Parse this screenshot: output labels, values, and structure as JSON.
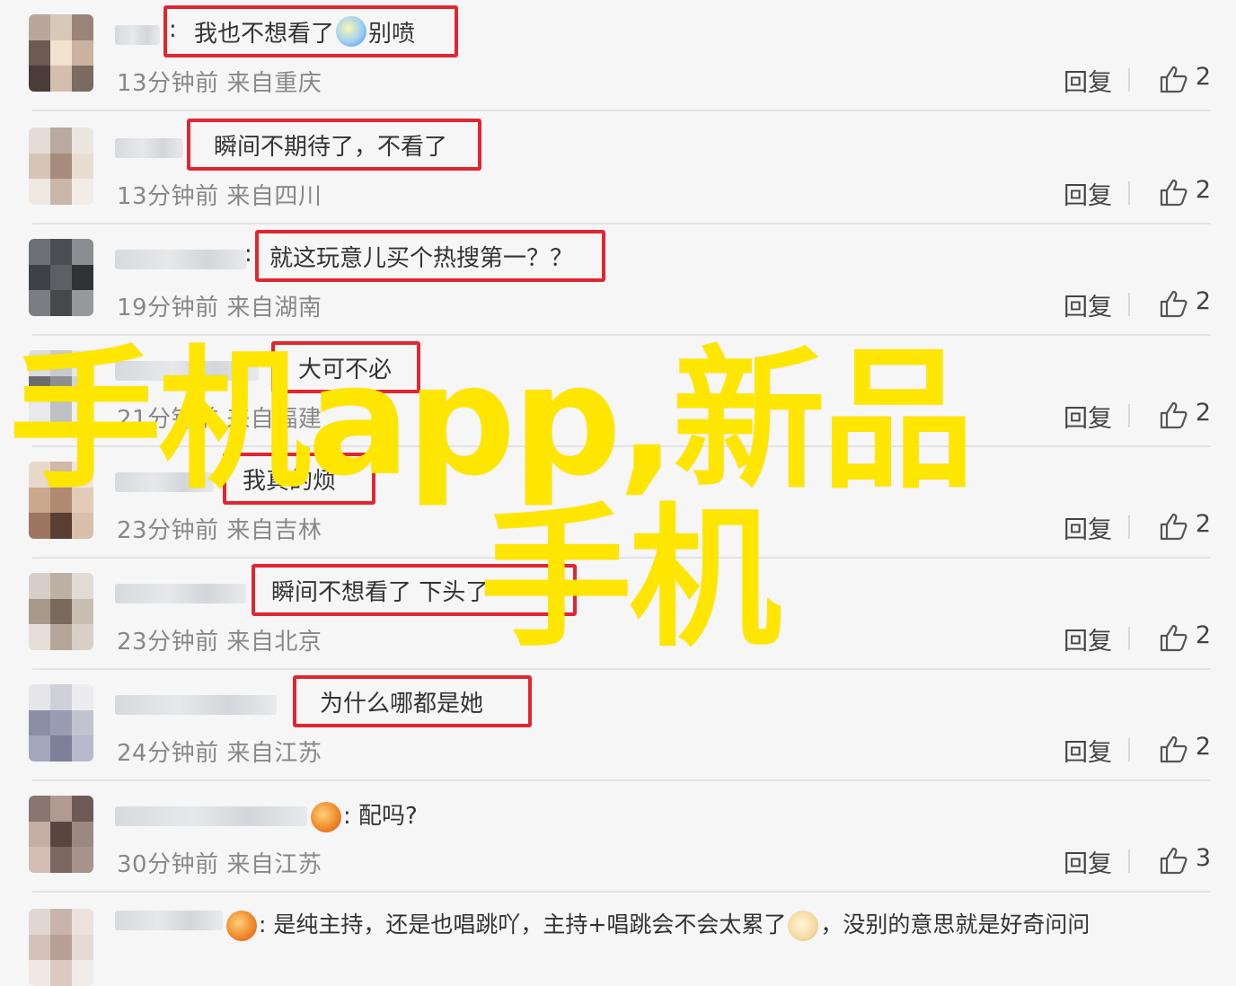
{
  "comments": [
    {
      "comment": "我也不想看了",
      "comment_suffix": "别喷",
      "emoji": "grinning-sweat-emoji",
      "meta": "13分钟前 来自重庆",
      "reply": "回复",
      "likes": "2"
    },
    {
      "comment": "瞬间不期待了，不看了",
      "meta": "13分钟前 来自四川",
      "reply": "回复",
      "likes": "2"
    },
    {
      "comment": "就这玩意儿买个热搜第一？？",
      "meta": "19分钟前 来自湖南",
      "reply": "回复",
      "likes": "2"
    },
    {
      "comment": "大可不必",
      "meta": "21分钟前 来自福建",
      "reply": "回复",
      "likes": "2"
    },
    {
      "comment": "我真的烦",
      "meta": "23分钟前 来自吉林",
      "reply": "回复",
      "likes": "2"
    },
    {
      "comment": "瞬间不想看了 下头了",
      "meta": "23分钟前 来自北京",
      "reply": "回复",
      "likes": "2"
    },
    {
      "comment": "为什么哪都是她",
      "meta": "24分钟前 来自江苏",
      "reply": "回复",
      "likes": "2"
    },
    {
      "comment": "配吗?",
      "emoji": "rooster-badge-emoji",
      "meta": "30分钟前 来自江苏",
      "reply": "回复",
      "likes": "3"
    },
    {
      "comment": "是纯主持，还是也唱跳吖，主持+唱跳会不会太累了",
      "comment_suffix": "，没别的意思就是好奇问问",
      "emoji": "rooster-badge-emoji",
      "emoji2": "dog-face-emoji"
    }
  ],
  "separator": ":",
  "overlay": {
    "line1": "手机app,新品",
    "line2": "手机"
  },
  "colors": {
    "highlight_border": "#e2262f",
    "overlay_text": "#ffe600"
  }
}
